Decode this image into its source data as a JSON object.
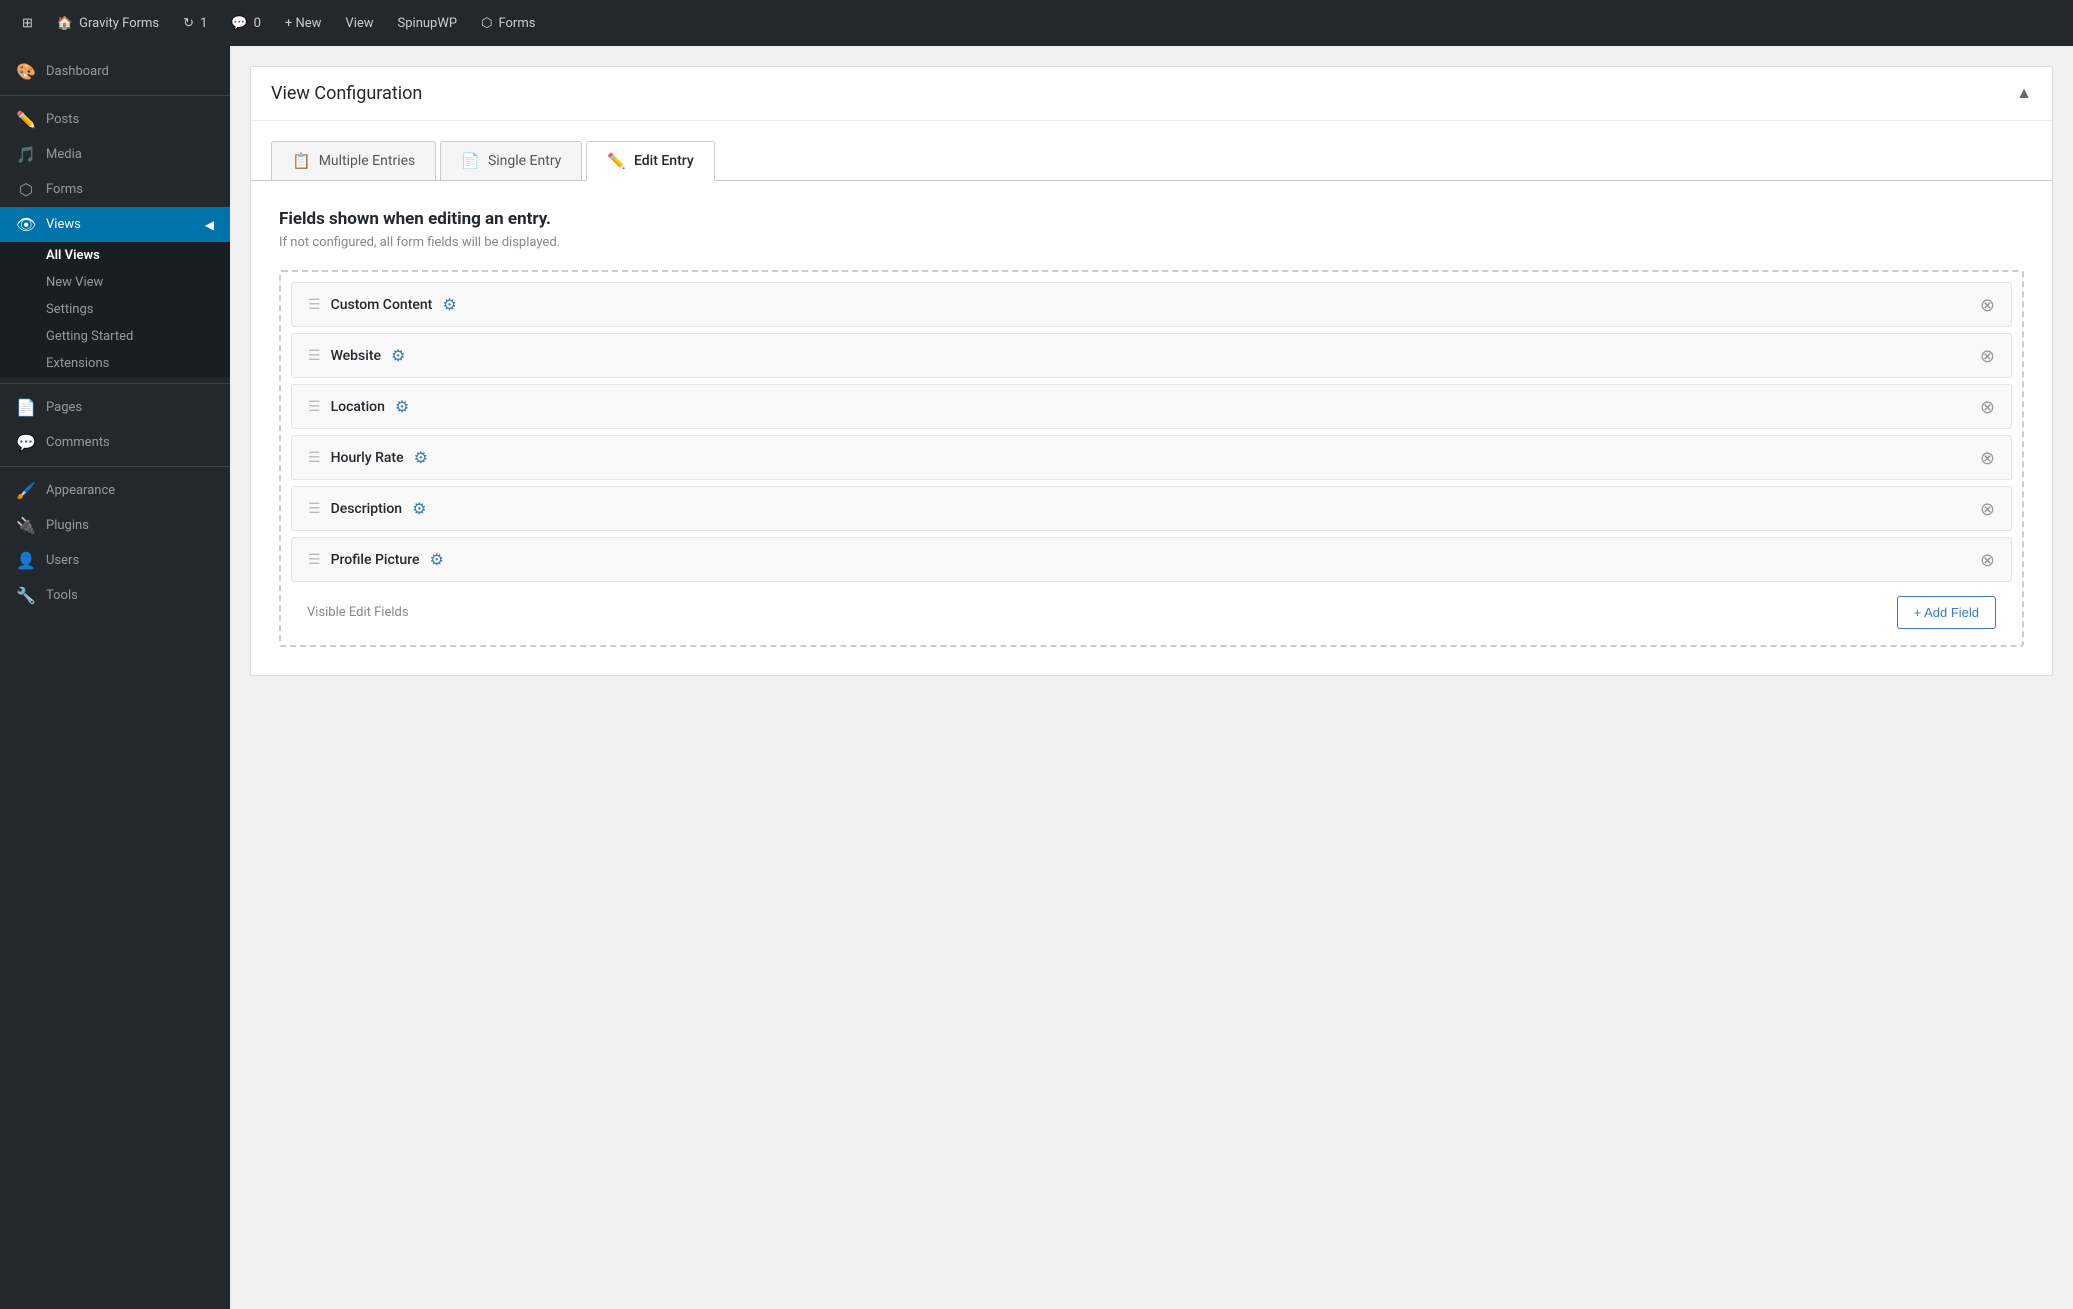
{
  "adminbar": {
    "wp_icon": "⊞",
    "site_name": "Gravity Forms",
    "updates_icon": "↻",
    "updates_count": "1",
    "comments_icon": "💬",
    "comments_count": "0",
    "new_label": "+ New",
    "view_label": "View",
    "spinupwp_label": "SpinupWP",
    "forms_icon": "⬡",
    "forms_label": "Forms"
  },
  "sidebar": {
    "dashboard_label": "Dashboard",
    "posts_label": "Posts",
    "media_label": "Media",
    "forms_label": "Forms",
    "views_label": "Views",
    "submenu": {
      "all_views": "All Views",
      "new_view": "New View",
      "settings": "Settings",
      "getting_started": "Getting Started",
      "extensions": "Extensions"
    },
    "pages_label": "Pages",
    "comments_label": "Comments",
    "appearance_label": "Appearance",
    "plugins_label": "Plugins",
    "users_label": "Users",
    "tools_label": "Tools"
  },
  "panel": {
    "title": "View Configuration",
    "collapse_icon": "▲"
  },
  "tabs": [
    {
      "id": "multiple-entries",
      "icon": "📄",
      "label": "Multiple Entries",
      "active": false
    },
    {
      "id": "single-entry",
      "icon": "📄",
      "label": "Single Entry",
      "active": false
    },
    {
      "id": "edit-entry",
      "icon": "✏️",
      "label": "Edit Entry",
      "active": true
    }
  ],
  "tab_content": {
    "heading": "Fields shown when editing an entry.",
    "subheading": "If not configured, all form fields will be displayed.",
    "fields": [
      {
        "label": "Custom Content"
      },
      {
        "label": "Website"
      },
      {
        "label": "Location"
      },
      {
        "label": "Hourly Rate"
      },
      {
        "label": "Description"
      },
      {
        "label": "Profile Picture"
      }
    ],
    "footer_label": "Visible Edit Fields",
    "add_field_btn": "+ Add Field"
  }
}
